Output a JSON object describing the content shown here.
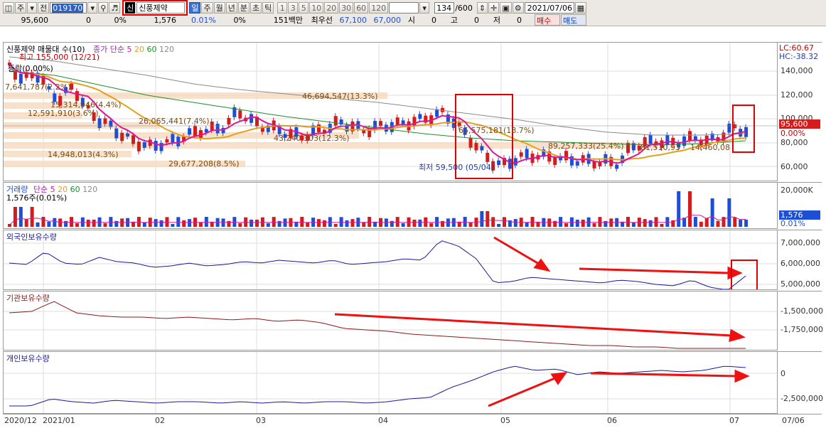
{
  "toolbar": {
    "row1": {
      "mode_daily": "주",
      "prev_label": "전",
      "stock_code": "019170",
      "sin_badge": "신",
      "stock_name": "신풍제약",
      "period_tabs": [
        "일",
        "주",
        "월",
        "년",
        "분",
        "초",
        "틱"
      ],
      "active_period": "일",
      "interval_buttons": [
        "1",
        "3",
        "5",
        "10",
        "20",
        "30",
        "60",
        "120"
      ],
      "count_display": "134",
      "count_total": "/600",
      "date_value": "2021/07/06"
    },
    "row2": {
      "price": "95,600",
      "change": "0",
      "change_pct": "0%",
      "volume": "1,576",
      "volume_pct": "0.01%",
      "pct2": "0%",
      "amount": "151백만",
      "bid_label": "최우선",
      "bid1": "67,100",
      "bid2": "67,000",
      "open_label": "시",
      "open_val": "0",
      "high_label": "고",
      "high_val": "0",
      "low_label": "저",
      "low_val": "0",
      "buy_button": "매수",
      "sell_button": "매도"
    }
  },
  "price_panel": {
    "title_stock": "신풍제약 매물대 수(10)",
    "title_ma": "종가 단순",
    "ma_periods": [
      "5",
      "20",
      "60",
      "120"
    ],
    "ma_colors": [
      "#d6189a",
      "#e3a11a",
      "#1d8f2a",
      "#8a8a8a"
    ],
    "high_note": "최고 155,000 (12/21)",
    "rate_note": "등락(0.00%)",
    "low_note": "최저 59,500 (05/04)",
    "lc": "LC:60.67",
    "hc": "HC:-38.32",
    "current_price_tag": "95,600",
    "current_pct_tag": "0.00%",
    "yaxis": [
      "140,000",
      "120,000",
      "100,000",
      "80,000",
      "60,000"
    ],
    "volume_profile": [
      {
        "label": "46,694,547(13.3%)"
      },
      {
        "label": "7,641,787(2.2%)"
      },
      {
        "label": "15,314,946(4.4%)"
      },
      {
        "label": "12,591,910(3.6%)"
      },
      {
        "label": "26,065,441(7.4%)"
      },
      {
        "label": "65,575,181(18.7%)"
      },
      {
        "label": "43,240,303(12.3%)"
      },
      {
        "label": "89,257,333(25.4%)"
      },
      {
        "label": "81,510,93"
      },
      {
        "label": "14,460,08"
      },
      {
        "label": "14,948,013(4.3%)"
      },
      {
        "label": "29,677,208(8.5%)"
      }
    ]
  },
  "volume_panel": {
    "title": "거래량",
    "ma_label": "단순",
    "ma_periods": [
      "5",
      "20",
      "60",
      "120"
    ],
    "sub": "1,576주(0.01%)",
    "yaxis_top": "20,000K",
    "tag_value": "1,576",
    "tag_pct": "0.01%"
  },
  "foreign_panel": {
    "title": "외국인보유수량",
    "yaxis": [
      "7,000,000",
      "6,000,000",
      "5,000,000"
    ]
  },
  "inst_panel": {
    "title": "기관보유수량",
    "yaxis": [
      "-1,500,000",
      "-1,750,000"
    ]
  },
  "indiv_panel": {
    "title": "개인보유수량",
    "yaxis": [
      "0",
      "-2,500,000"
    ]
  },
  "date_axis": {
    "labels": [
      "2020/12",
      "2021/01",
      "02",
      "03",
      "04",
      "05",
      "06",
      "07",
      "07/06"
    ]
  }
}
